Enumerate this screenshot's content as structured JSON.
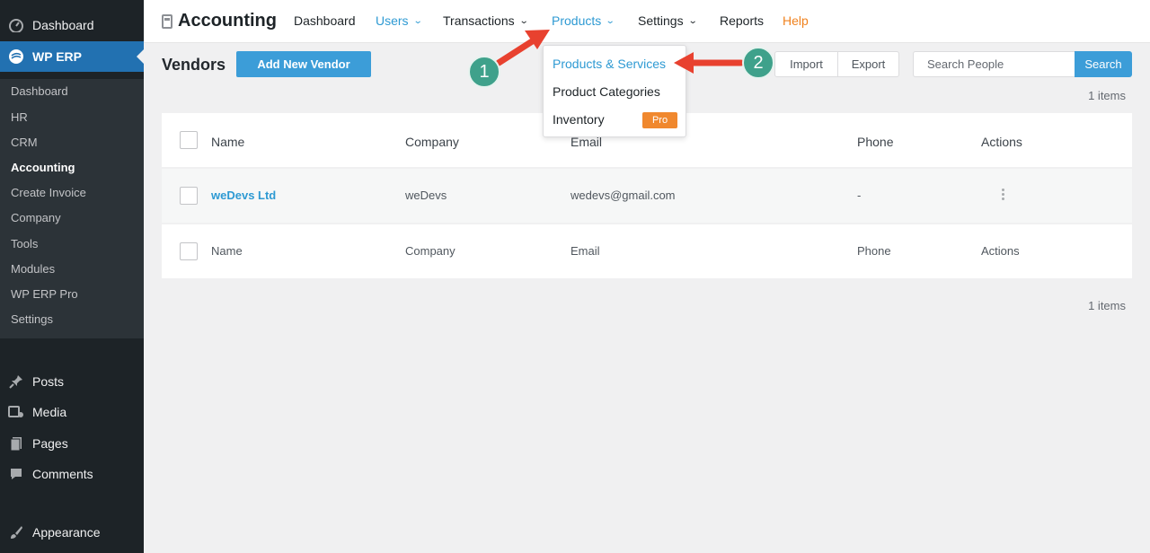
{
  "sidebar": {
    "top": [
      {
        "label": "Dashboard",
        "icon": "dashboard-icon"
      },
      {
        "label": "WP ERP",
        "icon": "wperp-logo-icon"
      }
    ],
    "submenu": [
      "Dashboard",
      "HR",
      "CRM",
      "Accounting",
      "Create Invoice",
      "Company",
      "Tools",
      "Modules",
      "WP ERP Pro",
      "Settings"
    ],
    "bottom": [
      {
        "label": "Posts",
        "icon": "pin-icon"
      },
      {
        "label": "Media",
        "icon": "media-icon"
      },
      {
        "label": "Pages",
        "icon": "pages-icon"
      },
      {
        "label": "Comments",
        "icon": "comment-icon"
      },
      {
        "label": "Appearance",
        "icon": "brush-icon"
      }
    ]
  },
  "topnav": {
    "title": "Accounting",
    "links": [
      "Dashboard",
      "Users",
      "Transactions",
      "Products",
      "Settings",
      "Reports",
      "Help"
    ]
  },
  "dropdown": {
    "items": [
      "Products & Services",
      "Product Categories",
      "Inventory"
    ],
    "badge": "Pro"
  },
  "page": {
    "title": "Vendors",
    "add_button": "Add New Vendor",
    "import": "Import",
    "export": "Export",
    "search_placeholder": "Search People",
    "search_button": "Search",
    "items_count": "1 items"
  },
  "table": {
    "columns": [
      "Name",
      "Company",
      "Email",
      "Phone",
      "Actions"
    ],
    "rows": [
      {
        "name": "weDevs Ltd",
        "company": "weDevs",
        "email": "wedevs@gmail.com",
        "phone": "-"
      }
    ]
  },
  "annotations": [
    "1",
    "2"
  ],
  "colors": {
    "accent": "#3c9dd8",
    "sidebar": "#1d2327",
    "arrow": "#e8412f",
    "step_badge": "#3fa18b",
    "pro_badge": "#f0882e"
  }
}
